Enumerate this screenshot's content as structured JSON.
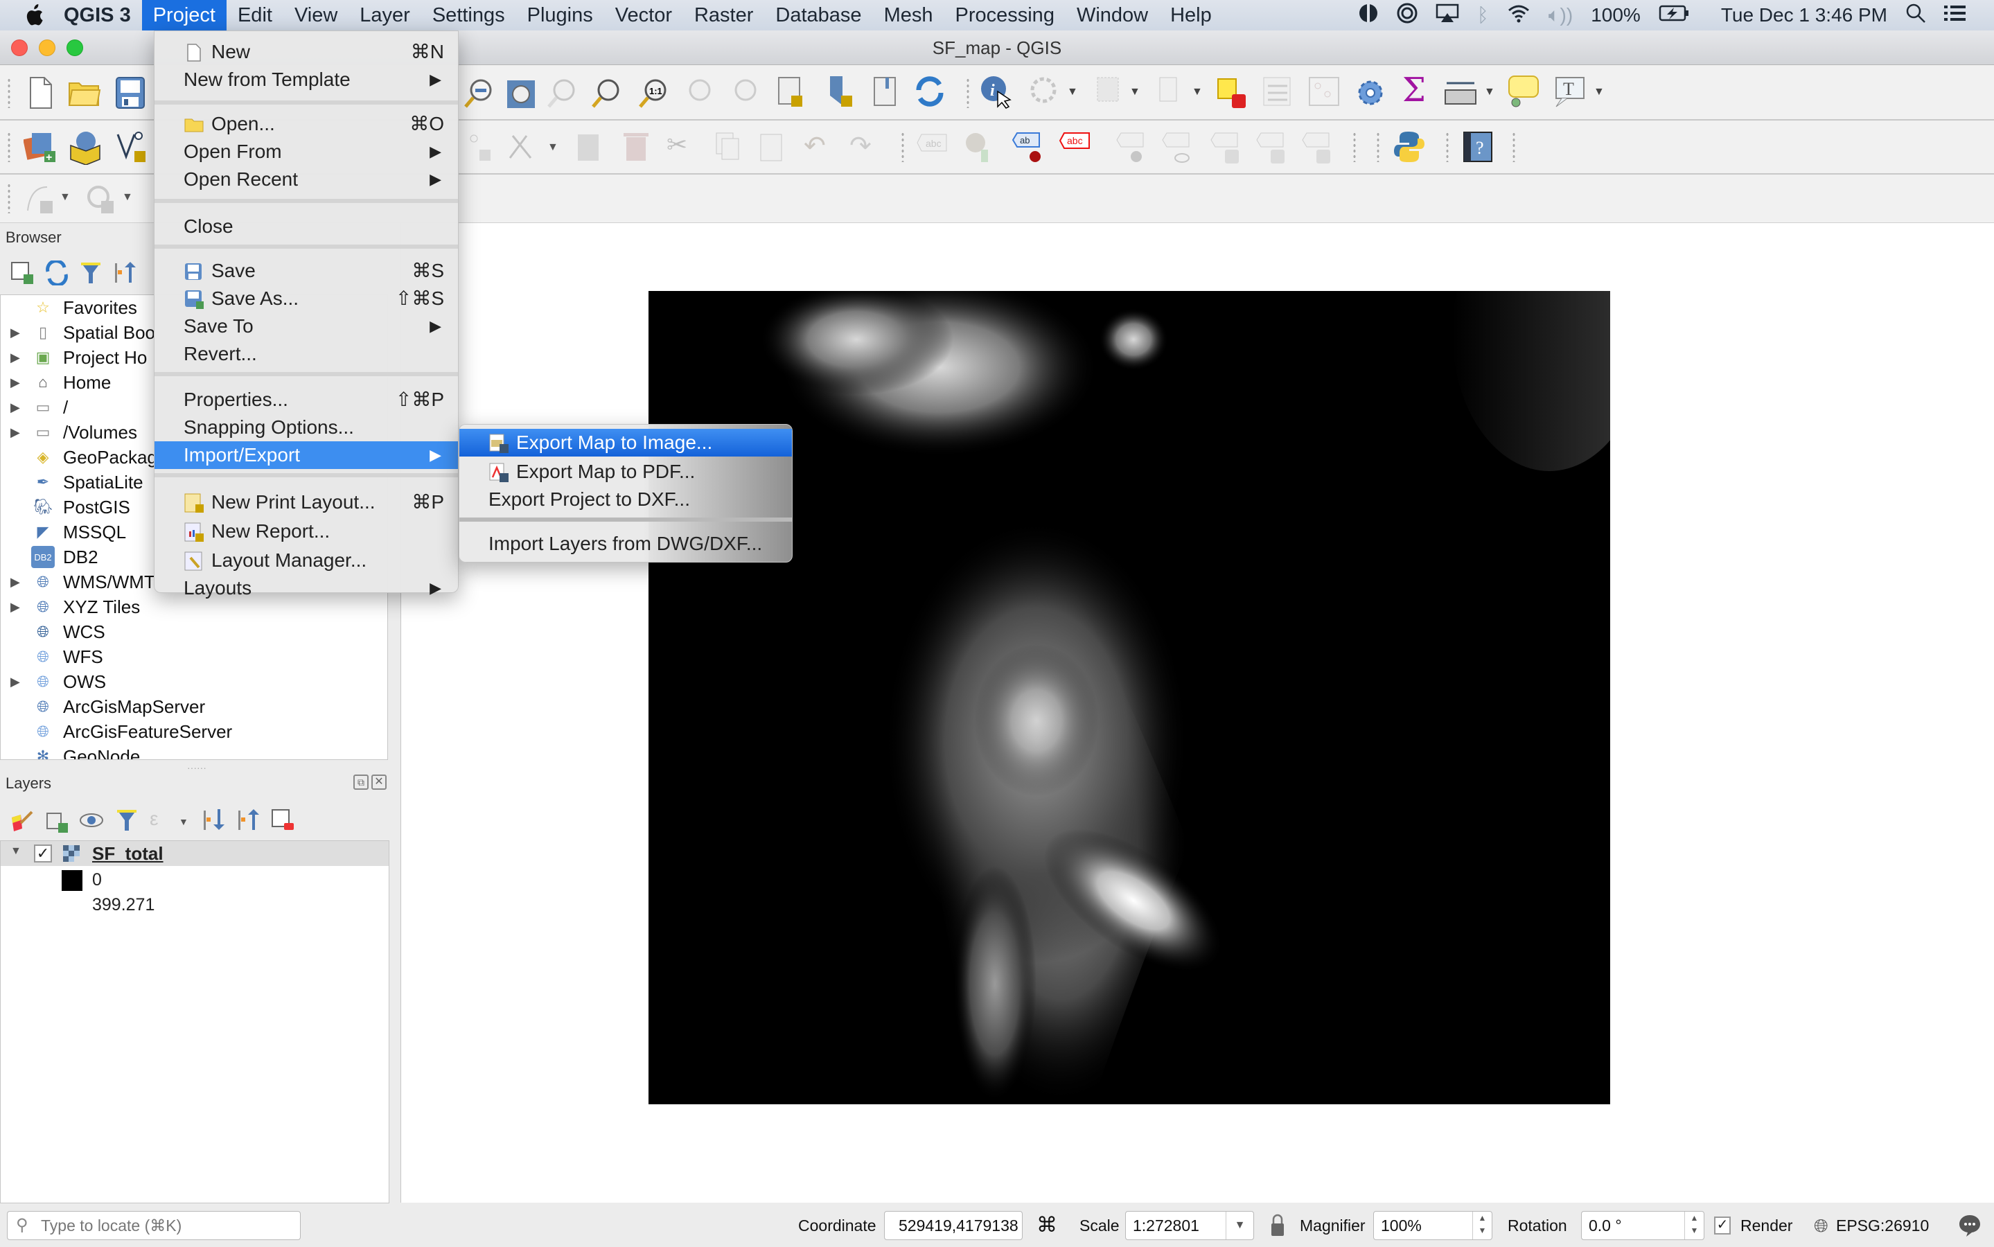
{
  "menubar": {
    "apple_icon": "apple-logo-icon",
    "app_name": "QGIS 3",
    "items": [
      "Project",
      "Edit",
      "View",
      "Layer",
      "Settings",
      "Plugins",
      "Vector",
      "Raster",
      "Database",
      "Mesh",
      "Processing",
      "Window",
      "Help"
    ],
    "active": "Project",
    "status": {
      "battery": "100%",
      "datetime": "Tue Dec 1  3:46 PM"
    }
  },
  "window": {
    "title": "SF_map - QGIS"
  },
  "project_menu": {
    "items": [
      {
        "label": "New",
        "shortcut": "⌘N",
        "icon": "new-document-icon"
      },
      {
        "label": "New from Template",
        "submenu": true
      },
      {
        "label": "Open...",
        "shortcut": "⌘O",
        "icon": "folder-icon"
      },
      {
        "label": "Open From",
        "submenu": true
      },
      {
        "label": "Open Recent",
        "submenu": true
      },
      {
        "label": "Close"
      },
      {
        "label": "Save",
        "shortcut": "⌘S",
        "icon": "save-icon"
      },
      {
        "label": "Save As...",
        "shortcut": "⇧⌘S",
        "icon": "save-as-icon"
      },
      {
        "label": "Save To",
        "submenu": true
      },
      {
        "label": "Revert..."
      },
      {
        "label": "Properties...",
        "shortcut": "⇧⌘P"
      },
      {
        "label": "Snapping Options..."
      },
      {
        "label": "Import/Export",
        "submenu": true,
        "highlighted": true
      },
      {
        "label": "New Print Layout...",
        "shortcut": "⌘P",
        "icon": "print-layout-icon"
      },
      {
        "label": "New Report...",
        "icon": "report-icon"
      },
      {
        "label": "Layout Manager...",
        "icon": "layout-manager-icon"
      },
      {
        "label": "Layouts",
        "submenu": true
      }
    ]
  },
  "import_export_submenu": {
    "items": [
      {
        "label": "Export Map to Image...",
        "icon": "export-image-icon",
        "highlighted": true
      },
      {
        "label": "Export Map to PDF...",
        "icon": "export-pdf-icon"
      },
      {
        "label": "Export Project to DXF..."
      },
      {
        "label": "Import Layers from DWG/DXF..."
      }
    ]
  },
  "browser": {
    "title": "Browser",
    "items": [
      {
        "label": "Favorites",
        "expandable": false,
        "icon": "star-icon"
      },
      {
        "label": "Spatial Boo",
        "expandable": true,
        "icon": "bookmark-icon"
      },
      {
        "label": "Project Ho",
        "expandable": true,
        "icon": "project-home-icon"
      },
      {
        "label": "Home",
        "expandable": true,
        "icon": "home-folder-icon"
      },
      {
        "label": "/",
        "expandable": true,
        "icon": "folder-icon"
      },
      {
        "label": "/Volumes",
        "expandable": true,
        "icon": "folder-icon"
      },
      {
        "label": "GeoPackag",
        "expandable": false,
        "icon": "geopackage-icon"
      },
      {
        "label": "SpatiaLite",
        "expandable": false,
        "icon": "spatialite-icon"
      },
      {
        "label": "PostGIS",
        "expandable": false,
        "icon": "postgis-icon"
      },
      {
        "label": "MSSQL",
        "expandable": false,
        "icon": "mssql-icon"
      },
      {
        "label": "DB2",
        "expandable": false,
        "icon": "db2-icon"
      },
      {
        "label": "WMS/WMT",
        "expandable": true,
        "icon": "globe-icon"
      },
      {
        "label": "XYZ Tiles",
        "expandable": true,
        "icon": "globe-icon"
      },
      {
        "label": "WCS",
        "expandable": false,
        "icon": "wcs-globe-icon"
      },
      {
        "label": "WFS",
        "expandable": false,
        "icon": "wfs-globe-icon"
      },
      {
        "label": "OWS",
        "expandable": true,
        "icon": "ows-globe-icon"
      },
      {
        "label": "ArcGisMapServer",
        "expandable": false,
        "icon": "arcgis-map-icon"
      },
      {
        "label": "ArcGisFeatureServer",
        "expandable": false,
        "icon": "arcgis-feature-icon"
      },
      {
        "label": "GeoNode",
        "expandable": false,
        "icon": "geonode-icon"
      }
    ]
  },
  "layers": {
    "title": "Layers",
    "layer": {
      "name": "SF_total",
      "checked": true,
      "expanded": true
    },
    "legend": {
      "min": "0",
      "max": "399.271",
      "min_color": "#000000"
    }
  },
  "statusbar": {
    "locate_placeholder": "Type to locate (⌘K)",
    "coordinate_label": "Coordinate",
    "coordinate_value": "529419,4179138",
    "scale_label": "Scale",
    "scale_value": "1:272801",
    "magnifier_label": "Magnifier",
    "magnifier_value": "100%",
    "rotation_label": "Rotation",
    "rotation_value": "0.0 °",
    "render_label": "Render",
    "render_checked": true,
    "crs": "EPSG:26910"
  },
  "colors": {
    "menu_highlight": "#3d8ef0",
    "menubar_active": "#1a6fe0",
    "map_background": "#000000"
  }
}
